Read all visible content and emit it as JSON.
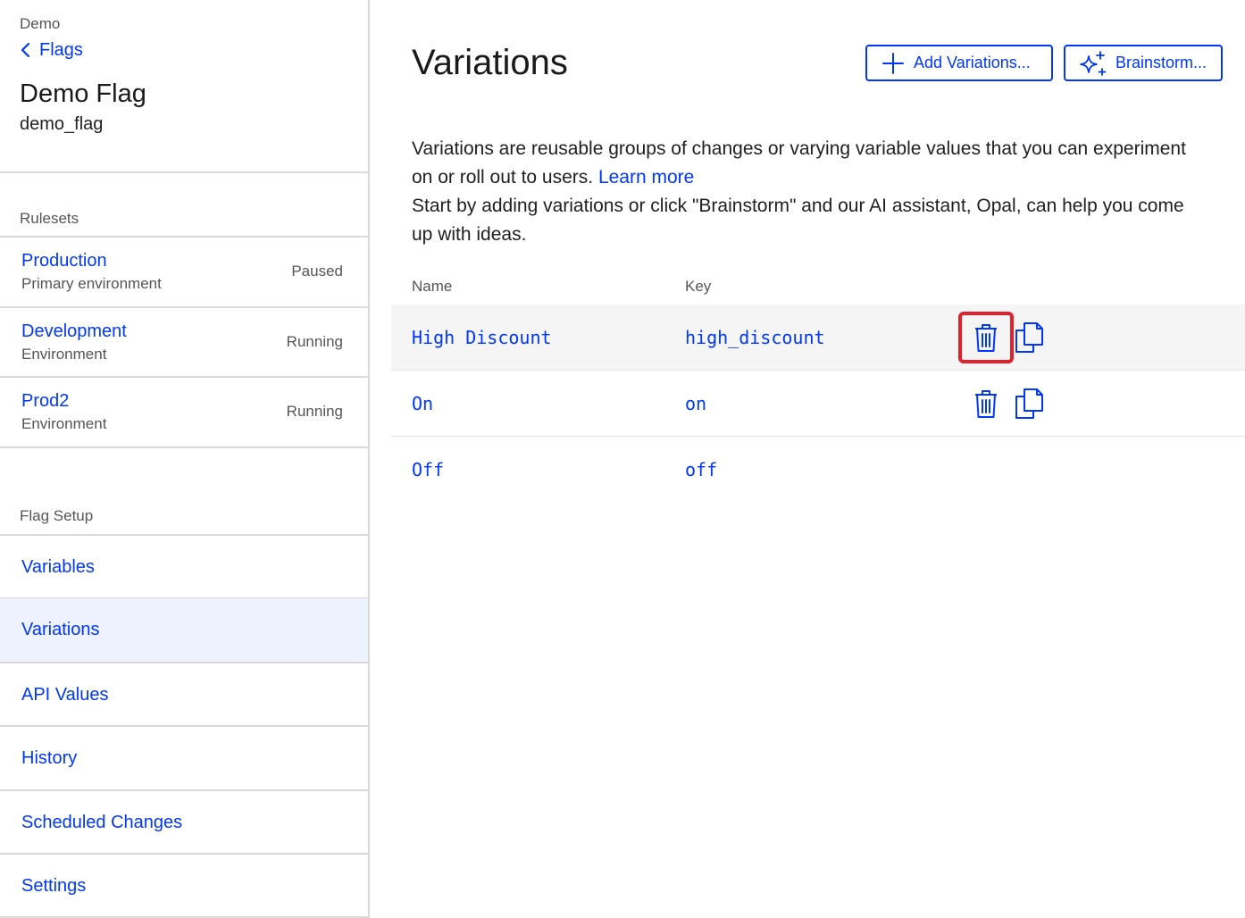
{
  "sidebar": {
    "project": "Demo",
    "back_label": "Flags",
    "flag_title": "Demo Flag",
    "flag_key": "demo_flag",
    "rulesets_label": "Rulesets",
    "rulesets": [
      {
        "name": "Production",
        "subtitle": "Primary environment",
        "status": "Paused"
      },
      {
        "name": "Development",
        "subtitle": "Environment",
        "status": "Running"
      },
      {
        "name": "Prod2",
        "subtitle": "Environment",
        "status": "Running"
      }
    ],
    "setup_label": "Flag Setup",
    "nav": [
      {
        "label": "Variables"
      },
      {
        "label": "Variations",
        "active": true
      },
      {
        "label": "API Values"
      },
      {
        "label": "History"
      },
      {
        "label": "Scheduled Changes"
      },
      {
        "label": "Settings"
      }
    ]
  },
  "main": {
    "title": "Variations",
    "add_button": "Add Variations...",
    "brainstorm_button": "Brainstorm...",
    "description_line1": "Variations are reusable groups of changes or varying variable values that you can experiment on or roll out to users.",
    "learn_more": "Learn more",
    "description_line2": "Start by adding variations or click \"Brainstorm\" and our AI assistant, Opal, can help you come up with ideas.",
    "columns": {
      "name": "Name",
      "key": "Key"
    },
    "rows": [
      {
        "name": "High Discount",
        "key": "high_discount",
        "actions": true,
        "highlighted": true
      },
      {
        "name": "On",
        "key": "on",
        "actions": true
      },
      {
        "name": "Off",
        "key": "off",
        "actions": false
      }
    ]
  },
  "colors": {
    "accent": "#0037ff",
    "highlight": "#e0202a",
    "active_nav_bg": "#eef1fe"
  },
  "icons": [
    "chevron-left-icon",
    "plus-icon",
    "sparkle-icon",
    "trash-icon",
    "copy-icon"
  ]
}
